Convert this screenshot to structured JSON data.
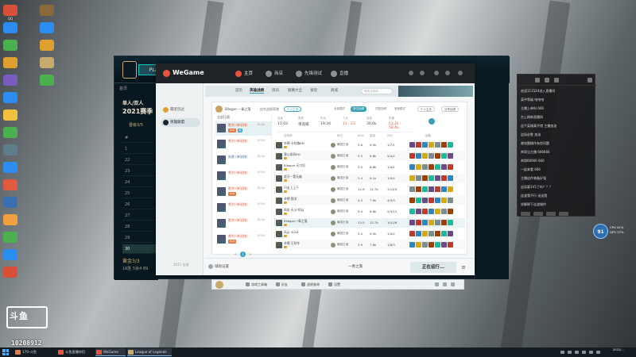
{
  "desktop": {
    "icon_labels": [
      "QQ",
      "",
      "",
      "",
      "",
      "",
      "",
      "",
      "",
      "",
      "",
      "",
      "",
      "",
      "",
      "",
      "",
      "",
      "",
      "",
      ""
    ],
    "icon_colors": [
      "#d94f3a",
      "#2d8cf0",
      "#4caf50",
      "#e0a030",
      "#7a5cc0",
      "#2d8cf0",
      "#f0c040",
      "#4caf50",
      "#607d8b",
      "#2d8cf0",
      "#e05a3f",
      "#3a6fb0",
      "#f0a040",
      "#4caf50",
      "#2d8cf0",
      "#d94f3a",
      "#8a6a3a",
      "#2d8cf0",
      "#e0a030",
      "#c8aa6e",
      "#4caf50"
    ],
    "douyu_logo": "斗鱼",
    "room_id": "10208912"
  },
  "lol": {
    "play_label": "PLAY",
    "nav": [
      "首页",
      "",
      "封",
      "ht"
    ],
    "season_lines": [
      "单人/双人",
      "2021赛季"
    ],
    "sub": "晋级3/5",
    "rows": [
      {
        "rank": "#",
        "name": ""
      },
      {
        "rank": "1",
        "name": ""
      },
      {
        "rank": "22",
        "name": ""
      },
      {
        "rank": "23",
        "name": ""
      },
      {
        "rank": "24",
        "name": ""
      },
      {
        "rank": "25",
        "name": ""
      },
      {
        "rank": "26",
        "name": ""
      },
      {
        "rank": "27",
        "name": ""
      },
      {
        "rank": "28",
        "name": ""
      },
      {
        "rank": "29",
        "name": ""
      },
      {
        "rank": "30",
        "name": ""
      }
    ],
    "bottom_title": "黄金3/3",
    "bottom_sub": "16胜 5余4 89",
    "bottom_right": "2019"
  },
  "wegame": {
    "logo": "WeGame",
    "tabs": [
      {
        "label": "主页",
        "active": true
      },
      {
        "label": "商店",
        "active": false
      },
      {
        "label": "先锋测试",
        "active": false
      },
      {
        "label": "直播",
        "active": false
      }
    ],
    "left_items": [
      {
        "label": "最近玩过",
        "active": false,
        "color": "#e0a030"
      },
      {
        "label": "英雄联盟",
        "active": true,
        "color": "#1f2327"
      }
    ],
    "left_footer": "2011 全部",
    "bar_tabs": [
      {
        "label": "首页",
        "active": false
      },
      {
        "label": "英雄战绩",
        "active": true
      },
      {
        "label": "资讯",
        "active": false
      },
      {
        "label": "联赛大全",
        "active": false
      },
      {
        "label": "发现",
        "active": false
      },
      {
        "label": "商城",
        "active": false
      }
    ],
    "search_placeholder": "搜索召唤师",
    "profile": {
      "name": "Bilegon 一青之落",
      "link1": "综合战绩",
      "link2": "荣誉",
      "badge": "个人主页",
      "filters": [
        {
          "label": "全部模式",
          "active": false
        },
        {
          "label": "排位战绩",
          "active": true
        },
        {
          "label": "匹配战绩",
          "active": false
        },
        {
          "label": "其他模式",
          "active": false
        }
      ],
      "btns": [
        "个人主页",
        "分享战绩"
      ]
    },
    "match_header": "全部比赛",
    "matches": [
      {
        "result": "胜利 (单双排)",
        "win": true,
        "time": "15:00",
        "tag": "MVP",
        "tag2": "超"
      },
      {
        "result": "胜利 (单双排)",
        "win": true,
        "time": "15:00",
        "tag": "",
        "tag2": ""
      },
      {
        "result": "失败 (单双排)",
        "win": false,
        "time": "15:00",
        "tag": "",
        "tag2": ""
      },
      {
        "result": "胜利 (单双排)",
        "win": true,
        "time": "15:00",
        "tag": "",
        "tag2": ""
      },
      {
        "result": "胜利 (单双排)",
        "win": true,
        "time": "15:00",
        "tag": "MVP",
        "tag2": ""
      },
      {
        "result": "胜利 (单双排)",
        "win": true,
        "time": "15:00",
        "tag": "",
        "tag2": ""
      },
      {
        "result": "胜利 (单双排)",
        "win": true,
        "time": "15:00",
        "tag": "",
        "tag2": ""
      },
      {
        "result": "胜利 (单双排)",
        "win": true,
        "time": "15:00",
        "tag": "MVP",
        "tag2": ""
      }
    ],
    "pager": [
      "<",
      "1",
      ">"
    ],
    "summary": [
      {
        "label": "结束",
        "value": "11:03",
        "red": false
      },
      {
        "label": "类型",
        "value": "单双排",
        "red": false
      },
      {
        "label": "时长",
        "value": "19:34",
        "red": false
      },
      {
        "label": "人头",
        "value": "11 : 23",
        "red": true
      },
      {
        "label": "金钱",
        "value": "30.6k",
        "red": false
      },
      {
        "label": "伤害",
        "value": "53.2k : 58.4k",
        "red": true
      }
    ],
    "table_headers": [
      "召唤师",
      "段位",
      "KDA",
      "金钱",
      "评分",
      "装备"
    ],
    "players": [
      {
        "name": "辛德·卡拉森KM",
        "rank": "最强王者",
        "kda": "3.6",
        "gold": "9.5k",
        "score": "1/7/1",
        "self": false
      },
      {
        "name": "我心如风RD",
        "rank": "最强王者",
        "kda": "5.3",
        "gold": "9.8k",
        "score": "5/4/2",
        "self": false
      },
      {
        "name": "Bilegon·天刀坦",
        "rank": "最强王者",
        "kda": "3.5",
        "gold": "8.8k",
        "score": "1/4/1",
        "self": false
      },
      {
        "name": "虎牙丶我无敌",
        "rank": "最强王者",
        "kda": "3.4",
        "gold": "9.1k",
        "score": "1/5/4",
        "self": false
      },
      {
        "name": "闪击上上下",
        "rank": "最强王者",
        "kda": "12.9",
        "gold": "12.7k",
        "score": "11/3/4",
        "self": false
      },
      {
        "name": "辛德·我学",
        "rank": "最强王者",
        "kda": "4.3",
        "gold": "7.9k",
        "score": "4/4/3",
        "self": false
      },
      {
        "name": "鸡毛·天分·阿玩",
        "rank": "最强王者",
        "kda": "9.4",
        "gold": "8.6k",
        "score": "2/3/12",
        "self": false
      },
      {
        "name": "Bilegon一青之落",
        "rank": "最强王者",
        "kda": "13.5",
        "gold": "12.7k",
        "score": "10/1/8",
        "self": true
      },
      {
        "name": "风云·3016",
        "rank": "最强王者",
        "kda": "3.4",
        "gold": "5.5k",
        "score": "1/4/2",
        "self": false
      },
      {
        "name": "辛德·王秋冬",
        "rank": "最强王者",
        "kda": "3.9",
        "gold": "7.6k",
        "score": "1/8/3",
        "self": false
      }
    ],
    "footer_settings": "辅助设置",
    "footer_select": "一青之落",
    "running": "正在运行..."
  },
  "float_bar": {
    "buttons": [
      "游戏工具箱",
      "好友",
      "战绩查询",
      "设置"
    ]
  },
  "chat": {
    "lines": [
      {
        "user": "",
        "text": "欢迎111524进入直播间"
      },
      {
        "user": "",
        "text": "英中等级 哈哈哈"
      },
      {
        "user": "",
        "text": "主播上单吗 666"
      },
      {
        "user": "",
        "text": "台上刷新直播间"
      },
      {
        "user": "",
        "text": "这个英雄真不错 主播加油"
      },
      {
        "user": "",
        "text": "这局必胜 加油"
      },
      {
        "user": "",
        "text": "感觉跟操作有些问题"
      },
      {
        "user": "",
        "text": "帅哥当主播 666666"
      },
      {
        "user": "",
        "text": "帅哥66666 666"
      },
      {
        "user": "",
        "text": "一起来看 666"
      },
      {
        "user": "",
        "text": "主播这件装备好强"
      },
      {
        "user": "",
        "text": "这局要1V5了吗？？？"
      },
      {
        "user": "",
        "text": "这波我不行 送送我"
      },
      {
        "user": "",
        "text": "求解释下这波操作"
      }
    ]
  },
  "overlay": {
    "fps": "91",
    "info_lines": [
      "CPU 41%",
      "GPU 37%"
    ]
  },
  "taskbar": {
    "items": [
      {
        "label": "170-斗鱼",
        "active": false,
        "color": "#e87a4a"
      },
      {
        "label": "斗鱼直播伴侣",
        "active": false,
        "color": "#e05a3f"
      },
      {
        "label": "WeGame",
        "active": true,
        "color": "#e8553f"
      },
      {
        "label": "League of Legends",
        "active": true,
        "color": "#c8aa6e"
      }
    ],
    "clock_time": "2021/...",
    "clock_date": ""
  }
}
